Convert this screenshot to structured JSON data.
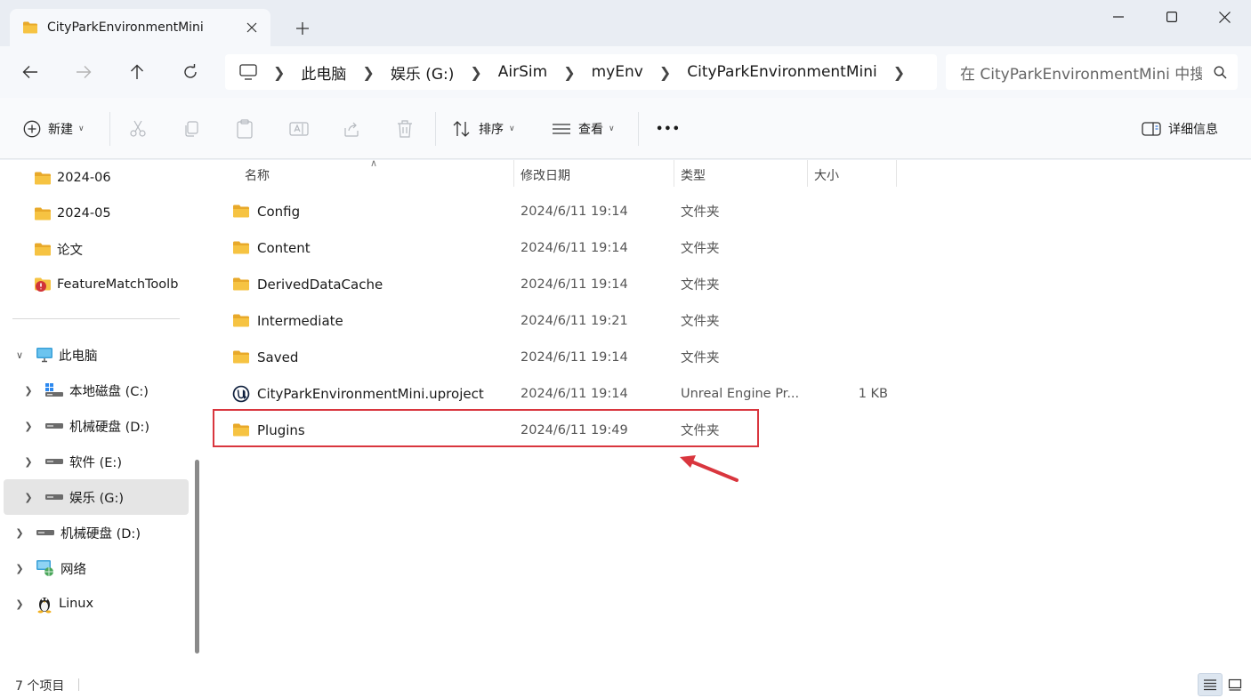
{
  "window": {
    "tab_title": "CityParkEnvironmentMini",
    "new_tab_symbol": "+"
  },
  "nav": {
    "breadcrumb": [
      "此电脑",
      "娱乐 (G:)",
      "AirSim",
      "myEnv",
      "CityParkEnvironmentMini"
    ],
    "search_placeholder": "在 CityParkEnvironmentMini 中搜"
  },
  "toolbar": {
    "new_label": "新建",
    "sort_label": "排序",
    "view_label": "查看",
    "more_symbol": "•••",
    "details_label": "详细信息"
  },
  "sidebar": {
    "quick_items": [
      {
        "label": "2024-06",
        "icon": "folder-icon"
      },
      {
        "label": "2024-05",
        "icon": "folder-icon"
      },
      {
        "label": "论文",
        "icon": "folder-icon"
      },
      {
        "label": "FeatureMatchToolb",
        "icon": "folder-warning-icon"
      }
    ],
    "this_pc": {
      "label": "此电脑",
      "icon": "monitor-icon"
    },
    "drives": [
      {
        "label": "本地磁盘 (C:)",
        "icon": "windows-drive-icon",
        "selected": false
      },
      {
        "label": "机械硬盘 (D:)",
        "icon": "drive-icon",
        "selected": false
      },
      {
        "label": "软件 (E:)",
        "icon": "drive-icon",
        "selected": false
      },
      {
        "label": "娱乐 (G:)",
        "icon": "drive-icon",
        "selected": true
      }
    ],
    "other_items": [
      {
        "label": "机械硬盘 (D:)",
        "icon": "drive-icon"
      },
      {
        "label": "网络",
        "icon": "network-icon"
      },
      {
        "label": "Linux",
        "icon": "linux-penguin-icon"
      }
    ]
  },
  "columns": {
    "name": "名称",
    "modified": "修改日期",
    "type": "类型",
    "size": "大小"
  },
  "files": [
    {
      "name": "Config",
      "modified": "2024/6/11 19:14",
      "type": "文件夹",
      "size": "",
      "icon": "folder-icon"
    },
    {
      "name": "Content",
      "modified": "2024/6/11 19:14",
      "type": "文件夹",
      "size": "",
      "icon": "folder-icon"
    },
    {
      "name": "DerivedDataCache",
      "modified": "2024/6/11 19:14",
      "type": "文件夹",
      "size": "",
      "icon": "folder-icon"
    },
    {
      "name": "Intermediate",
      "modified": "2024/6/11 19:21",
      "type": "文件夹",
      "size": "",
      "icon": "folder-icon"
    },
    {
      "name": "Saved",
      "modified": "2024/6/11 19:14",
      "type": "文件夹",
      "size": "",
      "icon": "folder-icon"
    },
    {
      "name": "CityParkEnvironmentMini.uproject",
      "modified": "2024/6/11 19:14",
      "type": "Unreal Engine Pr...",
      "size": "1 KB",
      "icon": "unreal-engine-icon"
    },
    {
      "name": "Plugins",
      "modified": "2024/6/11 19:49",
      "type": "文件夹",
      "size": "",
      "icon": "folder-icon"
    }
  ],
  "status": {
    "item_count": "7 个项目"
  },
  "colors": {
    "folder": "#f6c342",
    "folder_dark": "#e8a92a",
    "annotation_red": "#d9363e",
    "selected_bg": "#e5e5e5"
  }
}
